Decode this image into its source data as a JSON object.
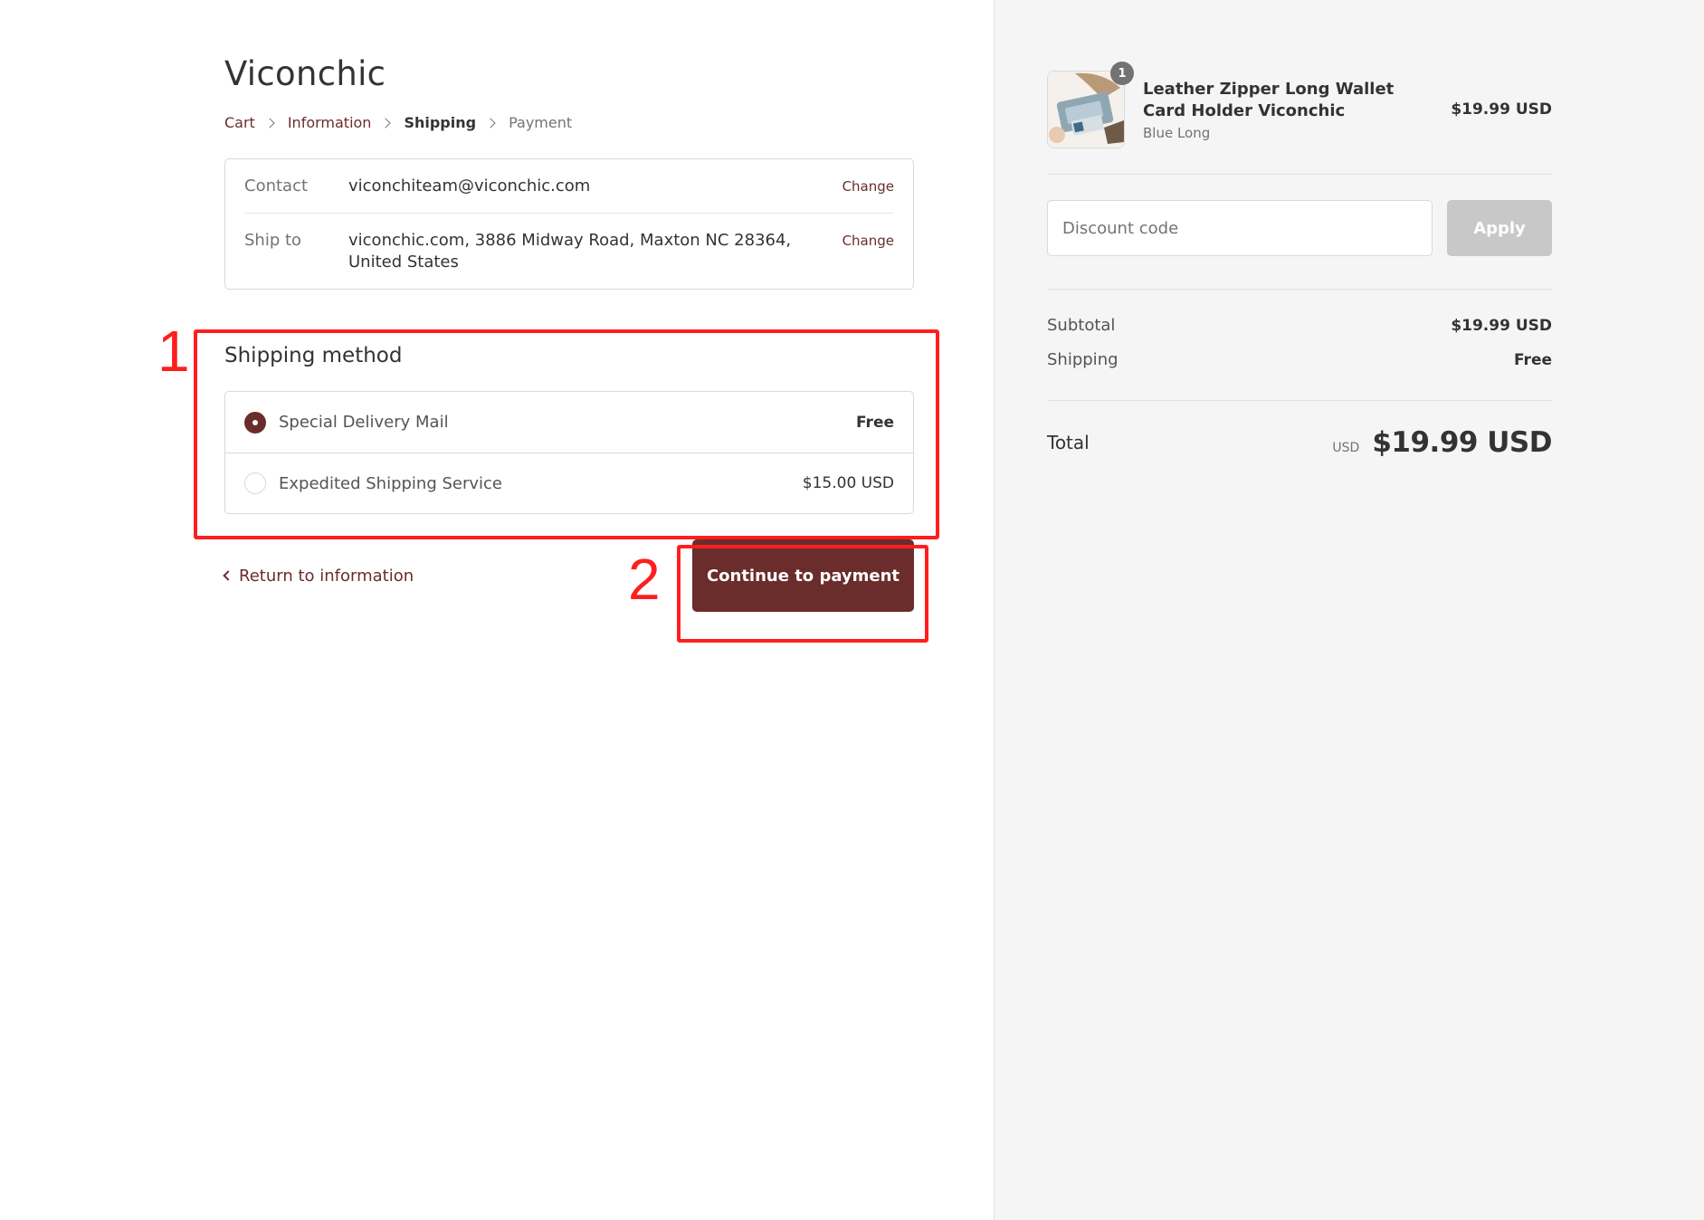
{
  "store": {
    "title": "Viconchic"
  },
  "breadcrumb": {
    "items": [
      {
        "label": "Cart",
        "state": "link"
      },
      {
        "label": "Information",
        "state": "link"
      },
      {
        "label": "Shipping",
        "state": "current"
      },
      {
        "label": "Payment",
        "state": "disabled"
      }
    ]
  },
  "review": {
    "contact": {
      "label": "Contact",
      "value": "viconchiteam@viconchic.com",
      "action": "Change"
    },
    "ship_to": {
      "label": "Ship to",
      "value": "viconchic.com, 3886 Midway Road, Maxton NC 28364, United States",
      "action": "Change"
    }
  },
  "shipping_method": {
    "title": "Shipping method",
    "options": [
      {
        "label": "Special Delivery Mail",
        "price": "Free",
        "selected": true
      },
      {
        "label": "Expedited Shipping Service",
        "price": "$15.00 USD",
        "selected": false
      }
    ]
  },
  "footer": {
    "return_label": "Return to information",
    "continue_label": "Continue to payment"
  },
  "annotations": [
    {
      "label": "1"
    },
    {
      "label": "2"
    }
  ],
  "order_summary": {
    "product": {
      "name": "Leather Zipper Long Wallet Card Holder Viconchic",
      "variant": "Blue Long",
      "price": "$19.99 USD",
      "quantity": "1"
    },
    "discount": {
      "placeholder": "Discount code",
      "button_label": "Apply"
    },
    "subtotal": {
      "label": "Subtotal",
      "value": "$19.99 USD"
    },
    "shipping": {
      "label": "Shipping",
      "value": "Free"
    },
    "total": {
      "label": "Total",
      "currency": "USD",
      "value": "$19.99 USD"
    }
  },
  "colors": {
    "accent": "#6b2c2c",
    "annotation": "#ff1e1e",
    "sidebar_bg": "#f5f5f5",
    "apply_disabled": "#c8c8c8"
  }
}
